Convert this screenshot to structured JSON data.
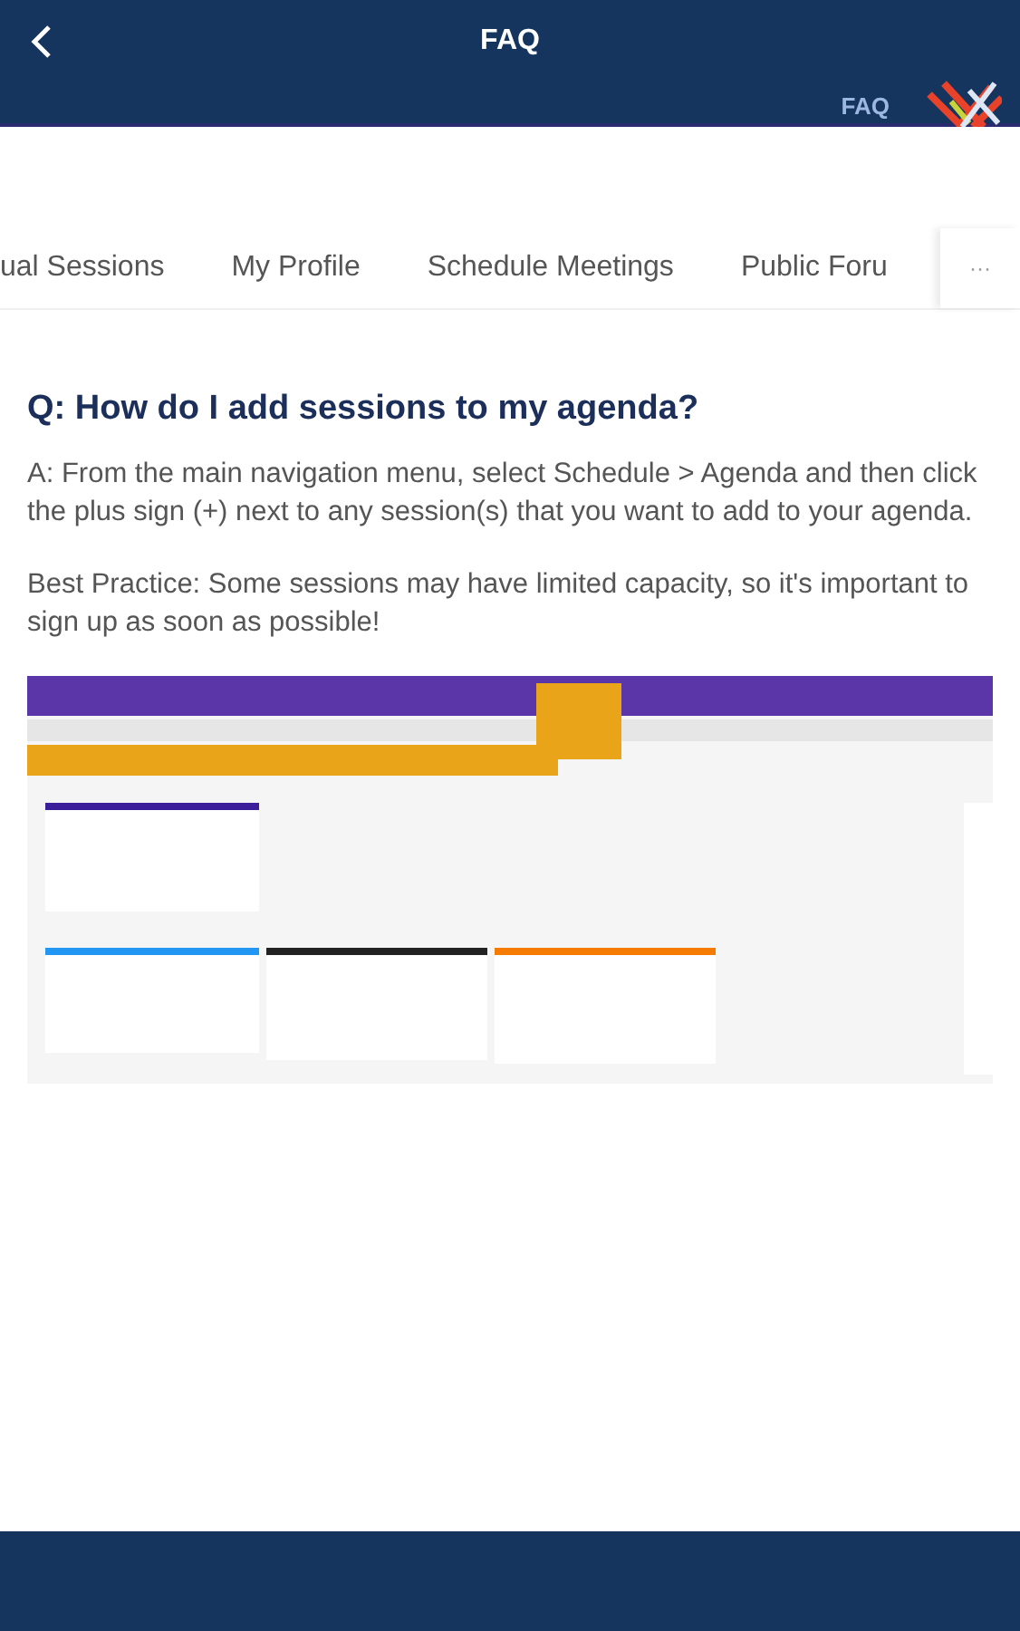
{
  "header": {
    "title": "FAQ",
    "subtitle": "FAQ"
  },
  "tabs": [
    {
      "label": "ual Sessions"
    },
    {
      "label": "My Profile"
    },
    {
      "label": "Schedule Meetings"
    },
    {
      "label": "Public Foru"
    }
  ],
  "more_button": {
    "label": "···"
  },
  "faq": {
    "question": "Q: How do I add sessions to my agenda?",
    "paragraphs": [
      "A: From the main navigation menu, select Schedule > Agenda and then click the plus sign (+) next to any session(s) that you want to add to your agenda.",
      "Best Practice: Some sessions may have limited capacity, so it's important to sign up as soon as possible!"
    ]
  }
}
